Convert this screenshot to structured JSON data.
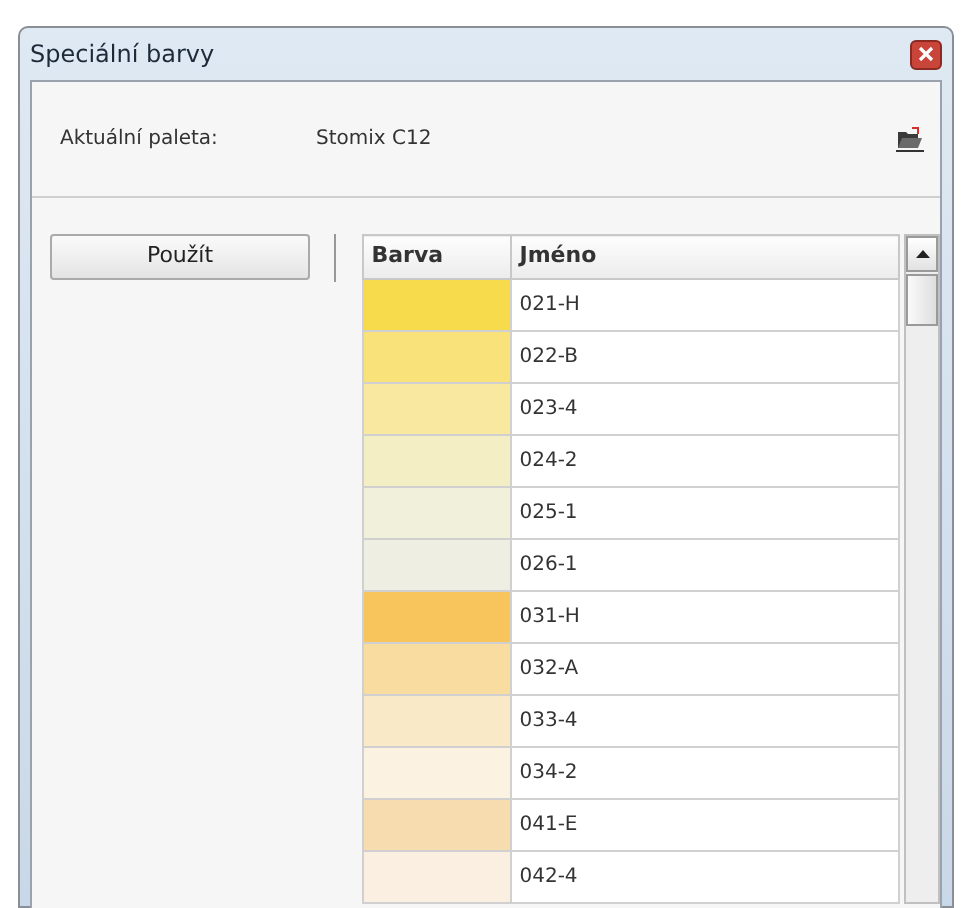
{
  "window": {
    "title": "Speciální barvy"
  },
  "palette": {
    "label": "Aktuální paleta:",
    "value": "Stomix C12"
  },
  "apply_button": "Použít",
  "table": {
    "columns": [
      "Barva",
      "Jméno"
    ],
    "rows": [
      {
        "color": "#f8db4c",
        "name": "021-H"
      },
      {
        "color": "#f9e27a",
        "name": "022-B"
      },
      {
        "color": "#f8e8a0",
        "name": "023-4"
      },
      {
        "color": "#f4eec4",
        "name": "024-2"
      },
      {
        "color": "#f1f0da",
        "name": "025-1"
      },
      {
        "color": "#eeeee2",
        "name": "026-1"
      },
      {
        "color": "#f7c55c",
        "name": "031-H"
      },
      {
        "color": "#f9dca0",
        "name": "032-A"
      },
      {
        "color": "#fae9c6",
        "name": "033-4"
      },
      {
        "color": "#fbf2e2",
        "name": "034-2"
      },
      {
        "color": "#f6dcae",
        "name": "041-E"
      },
      {
        "color": "#faefe0",
        "name": "042-4"
      }
    ]
  }
}
